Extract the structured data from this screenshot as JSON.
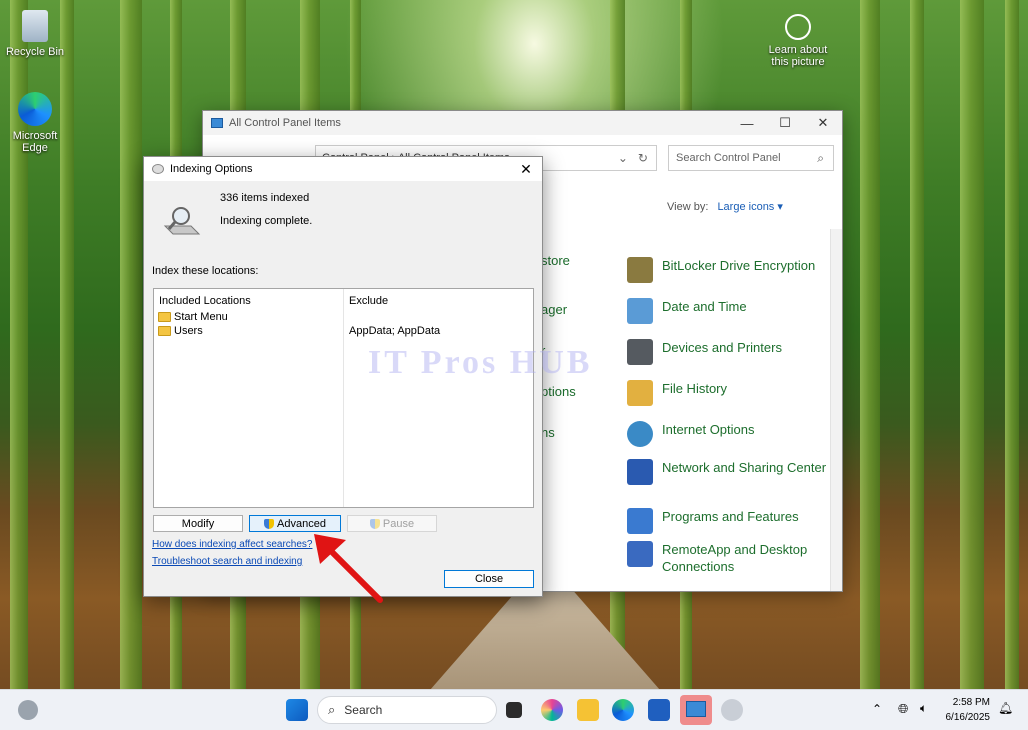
{
  "desktop": {
    "icons": [
      {
        "label": "Recycle Bin"
      },
      {
        "label": "Microsoft Edge"
      },
      {
        "label": "Learn about this picture"
      }
    ]
  },
  "control_panel": {
    "title": "All Control Panel Items",
    "address": "Control Panel  ›  All Control Panel Items",
    "search_placeholder": "Search Control Panel",
    "view_by_label": "View by:",
    "view_by_value": "Large icons ▾",
    "left_column_fragments": [
      "store",
      "ager",
      "r",
      "ptions",
      "ns"
    ],
    "items": [
      {
        "label": "BitLocker Drive Encryption",
        "icon": "bitlocker-icon",
        "color": "#8a7a40"
      },
      {
        "label": "Date and Time",
        "icon": "calendar-clock-icon",
        "color": "#5a9bd6"
      },
      {
        "label": "Devices and Printers",
        "icon": "printer-icon",
        "color": "#555a60"
      },
      {
        "label": "File History",
        "icon": "file-history-icon",
        "color": "#e2b040"
      },
      {
        "label": "Internet Options",
        "icon": "globe-icon",
        "color": "#3a8ac6"
      },
      {
        "label": "Network and Sharing Center",
        "icon": "network-icon",
        "color": "#2a5ab0"
      },
      {
        "label": "Programs and Features",
        "icon": "programs-icon",
        "color": "#3a7ad0"
      },
      {
        "label": "RemoteApp and Desktop Connections",
        "icon": "remote-desktop-icon",
        "color": "#3a6ac0"
      }
    ]
  },
  "indexing_dialog": {
    "title": "Indexing Options",
    "items_indexed": "336 items indexed",
    "status": "Indexing complete.",
    "index_locations_label": "Index these locations:",
    "columns": {
      "included": "Included Locations",
      "exclude": "Exclude"
    },
    "locations": [
      {
        "name": "Start Menu",
        "exclude": ""
      },
      {
        "name": "Users",
        "exclude": "AppData; AppData"
      }
    ],
    "buttons": {
      "modify": "Modify",
      "advanced": "Advanced",
      "pause": "Pause",
      "close": "Close"
    },
    "links": {
      "how": "How does indexing affect searches?",
      "troubleshoot": "Troubleshoot search and indexing"
    }
  },
  "watermark": "IT Pros HUB",
  "taskbar": {
    "search_label": "Search",
    "time": "2:58 PM",
    "date": "6/16/2025"
  }
}
